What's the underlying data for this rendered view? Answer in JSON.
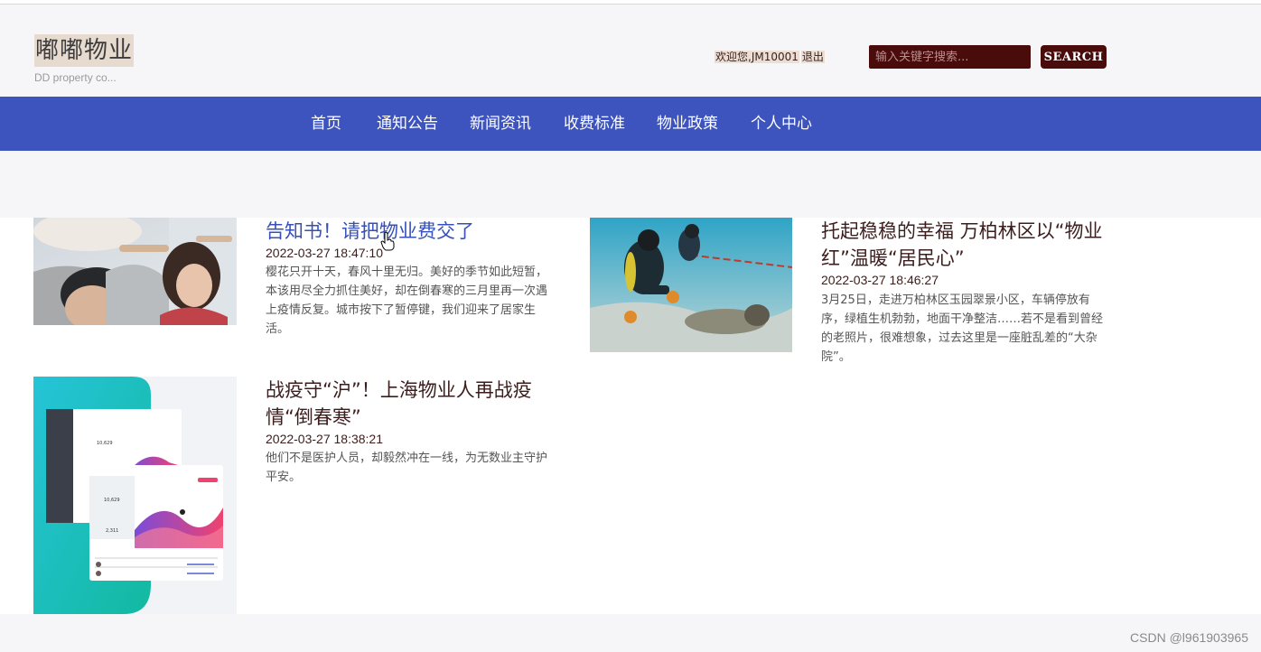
{
  "header": {
    "site_title": "嘟嘟物业",
    "site_subtitle": "DD property co...",
    "welcome_text": "欢迎您,JM10001",
    "logout_label": "退出",
    "search_placeholder": "输入关键字搜索...",
    "search_button": "SEARCH"
  },
  "nav": {
    "items": [
      {
        "label": "首页"
      },
      {
        "label": "通知公告"
      },
      {
        "label": "新闻资讯"
      },
      {
        "label": "收费标准"
      },
      {
        "label": "物业政策"
      },
      {
        "label": "个人中心"
      }
    ]
  },
  "news": [
    {
      "title": "告知书！请把物业费交了",
      "date": "2022-03-27 18:47:10",
      "summary": "樱花只开十天，春风十里无归。美好的季节如此短暂，本该用尽全力抓住美好，却在倒春寒的三月里再一次遇上疫情反复。城市按下了暂停键，我们迎来了居家生活。",
      "image_icon": "people-photo"
    },
    {
      "title": "托起稳稳的幸福 万柏林区以“物业红”温暖“居民心”",
      "date": "2022-03-27 18:46:27",
      "summary": "3月25日，走进万柏林区玉园翠景小区，车辆停放有序，绿植生机勃勃，地面干净整洁……若不是看到曾经的老照片，很难想象，过去这里是一座脏乱差的“大杂院”。",
      "image_icon": "diver-photo"
    },
    {
      "title": "战疫守“沪”！上海物业人再战疫情“倒春寒”",
      "date": "2022-03-27 18:38:21",
      "summary": "他们不是医护人员，却毅然冲在一线，为无数业主守护平安。",
      "image_icon": "dashboard-photo",
      "dashboard_stats": [
        "10,629",
        "2,311"
      ]
    }
  ],
  "watermark": "CSDN @l961903965",
  "colors": {
    "nav_bg": "#3d53bd",
    "search_bg": "#4a0b0b",
    "title_link": "#3650b8",
    "title_text": "#3c1d1d",
    "band_bg": "#f6f6f8"
  }
}
